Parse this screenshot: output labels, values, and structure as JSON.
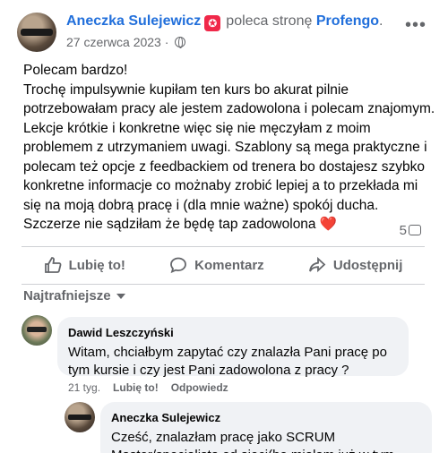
{
  "post": {
    "author": "Aneczka Sulejewicz",
    "recommend_text": "poleca stronę",
    "page_name": "Profengo",
    "page_suffix": ".",
    "date": "27 czerwca 2023",
    "date_sep": "·",
    "more_label": "•••",
    "paragraphs": [
      "Polecam bardzo!",
      "Trochę impulsywnie kupiłam ten kurs bo akurat pilnie potrzebowałam pracy ale jestem zadowolona i polecam znajomym. Lekcje krótkie i konkretne więc się nie męczyłam z moim problemem z utrzymaniem uwagi. Szablony są mega praktyczne i polecam też opcje z feedbackiem od trenera bo dostajesz szybko konkretne informacje co możnaby zrobić lepiej a to przekłada mi się na moją dobrą pracę i (dla mnie ważne) spokój ducha. Szczerze nie sądziłam że będę tap zadowolona"
    ],
    "heart": "❤️",
    "comment_count": "5",
    "actions": {
      "like": "Lubię to!",
      "comment": "Komentarz",
      "share": "Udostępnij"
    }
  },
  "sort": {
    "label": "Najtrafniejsze"
  },
  "comments": [
    {
      "author": "Dawid Leszczyński",
      "text": "Witam, chciałbym zapytać czy znalazła Pani pracę po tym kursie i czy jest Pani zadowolona z pracy ?",
      "time": "21 tyg.",
      "like": "Lubię to!",
      "reply": "Odpowiedz"
    },
    {
      "author": "Aneczka Sulejewicz",
      "text": "Cześć, znalazłam pracę jako SCRUM Master/specjalista od sieci(bo miałam już w tym"
    }
  ],
  "colors": {
    "link": "#216fdb",
    "muted": "#65676b",
    "bubble": "#f0f2f5",
    "badge": "#f02849",
    "heart": "#e41e3f"
  },
  "icons": [
    "badge-icon",
    "globe-icon",
    "more-icon",
    "comment-count-icon",
    "like-icon",
    "comment-icon",
    "share-icon",
    "caret-down-icon"
  ]
}
